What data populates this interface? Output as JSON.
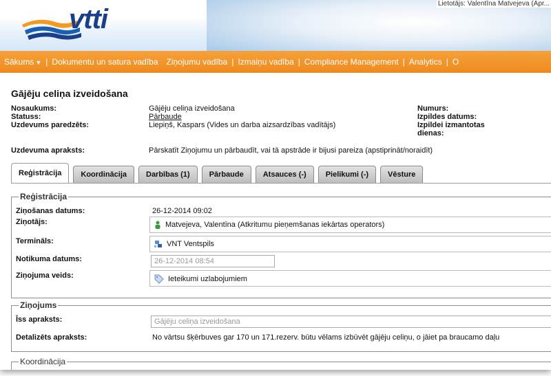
{
  "header": {
    "topbar_text": "Lietotājs: Valentīna Matvejeva (Apr...",
    "logo_text": "vtti"
  },
  "nav": {
    "items": [
      "Sākums",
      "Dokumentu un satura vadība",
      "Ziņojumu vadība",
      "Izmaiņu vadība",
      "Compliance Management",
      "Analytics",
      "O"
    ]
  },
  "page_title": "Gājēju celiņa izveidošana",
  "info": {
    "name_label": "Nosaukums:",
    "name_value": "Gājēju celiņa izveidošana",
    "status_label": "Statuss:",
    "status_value": "Pārbaude",
    "task_label": "Uzdevums paredzēts:",
    "task_value": "Liepiņš, Kaspars (Vides un darba aizsardzības vadītājs)",
    "number_label": "Numurs:",
    "due_label": "Izpildes datums:",
    "used_days_label": "Izpildei izmantotas dienas:",
    "desc_label": "Uzdevuma apraksts:",
    "desc_value": "Pārskatīt Ziņojumu un pārbaudīt, vai tā apstrāde ir bijusi pareiza (apstiprināt/noraidīt)"
  },
  "tabs": [
    "Reģistrācija",
    "Koordinācija",
    "Darbības (1)",
    "Pārbaude",
    "Atsauces (-)",
    "Pielikumi (-)",
    "Vēsture"
  ],
  "registration": {
    "legend": "Reģistrācija",
    "date_label": "Ziņošanas datums:",
    "date_value": "26-12-2014 09:02",
    "reporter_label": "Ziņotājs:",
    "reporter_value": "Matvejeva, Valentīna (Atkritumu pieņemšanas iekārtas operators)",
    "terminal_label": "Termināls:",
    "terminal_value": "VNT Ventspils",
    "event_date_label": "Notikuma datums:",
    "event_date_value": "26-12-2014 08:54",
    "type_label": "Ziņojuma veids:",
    "type_value": "Ieteikumi uzlabojumiem"
  },
  "report": {
    "legend": "Ziņojums",
    "short_label": "Īss apraksts:",
    "short_value": "Gājēju celiņa izveidošana",
    "detail_label": "Detalizēts apraksts:",
    "detail_value": "No vārtsu šķērbuves gar 170 un 171.rezerv. būtu vēlams izbūvēt gājēju celiņu, o jāiet pa braucamo daļu"
  },
  "coordination": {
    "legend": "Koordinācija"
  },
  "colors": {
    "nav_orange": "#ee8a1e",
    "logo_blue": "#1a3f8a",
    "logo_orange": "#f39a1f"
  }
}
